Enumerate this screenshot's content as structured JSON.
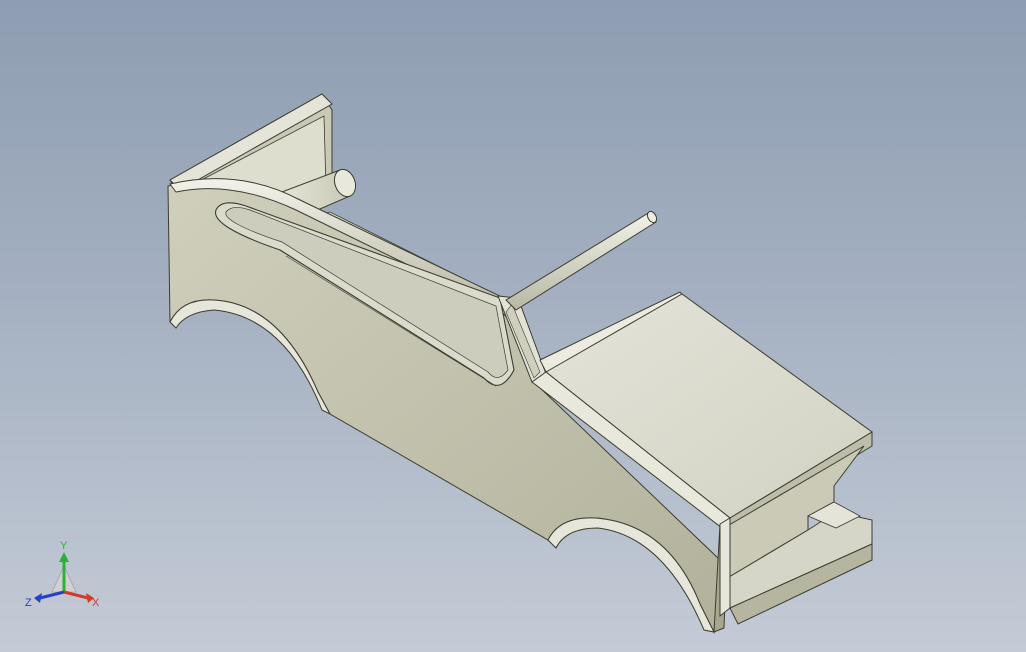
{
  "viewport": {
    "model_name": "",
    "colors": {
      "background_top": "#8e9db2",
      "background_bottom": "#c4cbd6",
      "part_face_light": "#dcdccf",
      "part_face_mid": "#cfcfbd",
      "part_face_dark": "#b4b49e",
      "edge": "#3c3c30"
    }
  },
  "triad": {
    "x_label": "X",
    "y_label": "Y",
    "z_label": "Z",
    "x_color": "#d23a2a",
    "y_color": "#2fae3a",
    "z_color": "#2840c8"
  }
}
